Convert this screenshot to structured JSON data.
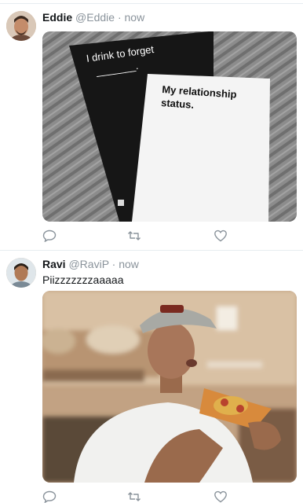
{
  "tweets": [
    {
      "name": "Eddie",
      "handle": "@Eddie",
      "dot": "·",
      "time": "now",
      "text": "",
      "image": {
        "card_black_text": "I drink to forget",
        "card_black_blank": "_______.",
        "card_white_text": "My relationship status."
      }
    },
    {
      "name": "Ravi",
      "handle": "@RaviP",
      "dot": "·",
      "time": "now",
      "text": "Piizzzzzzzaaaaa"
    }
  ],
  "icons": [
    "reply-icon",
    "retweet-icon",
    "like-icon"
  ],
  "colors": {
    "icon": "#8a939b",
    "divider": "#e6ecf0",
    "handle": "#8a939b"
  }
}
